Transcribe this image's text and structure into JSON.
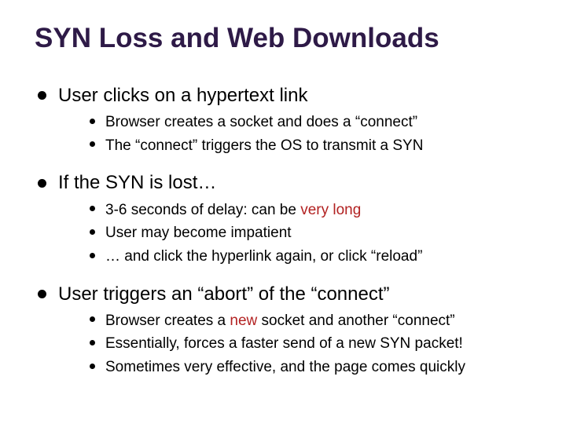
{
  "title": "SYN Loss and Web Downloads",
  "bullets": [
    {
      "text": "User clicks on a hypertext link",
      "sub": [
        {
          "text": "Browser creates a socket and does a “connect”"
        },
        {
          "text": "The “connect” triggers the OS to transmit a SYN"
        }
      ]
    },
    {
      "text": "If the SYN is lost…",
      "sub": [
        {
          "prefix": "3-6 seconds of delay: can be ",
          "highlight": "very long"
        },
        {
          "text": "User may become impatient"
        },
        {
          "text": "… and click the hyperlink again, or click “reload”"
        }
      ]
    },
    {
      "text": "User triggers an “abort” of the “connect”",
      "sub": [
        {
          "prefix": "Browser creates a ",
          "highlight": "new",
          "suffix": " socket and another “connect”"
        },
        {
          "text": "Essentially, forces a faster send of a new SYN packet!"
        },
        {
          "text": "Sometimes very effective, and the page comes quickly"
        }
      ]
    }
  ]
}
